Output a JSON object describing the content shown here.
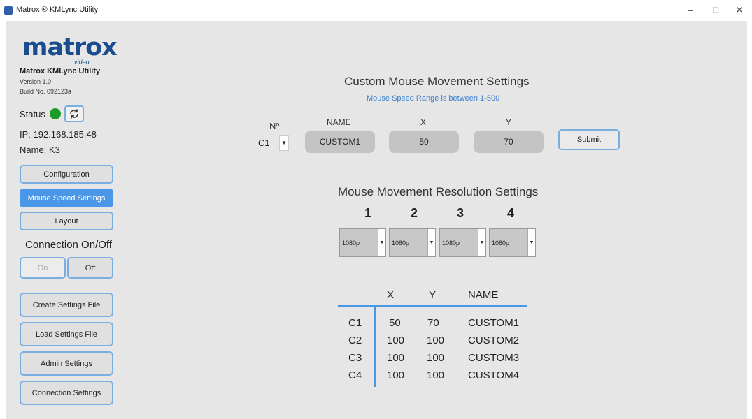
{
  "window": {
    "title": "Matrox ® KMLync Utility",
    "minimize": "–",
    "maximize": "☐",
    "close": "✕"
  },
  "sidebar": {
    "logo_text": "matrox",
    "logo_sub": "video",
    "app_name": "Matrox KMLync Utility",
    "version": "Version 1.0",
    "build": "Build No. 092123a",
    "status_label": "Status",
    "status_color": "#1e9a2a",
    "ip": "IP: 192.168.185.48",
    "name": "Name: K3",
    "nav": {
      "configuration": "Configuration",
      "mouse_speed": "Mouse Speed Settings",
      "layout": "Layout"
    },
    "connection_label": "Connection On/Off",
    "on": "On",
    "off": "Off",
    "create_settings": "Create Settings File",
    "load_settings": "Load Settings File",
    "admin_settings": "Admin Settings",
    "connection_settings": "Connection Settings"
  },
  "custom": {
    "title": "Custom Mouse Movement Settings",
    "range_note": "Mouse Speed Range is between 1-500",
    "col_no": "Nº",
    "col_name": "NAME",
    "col_x": "X",
    "col_y": "Y",
    "selected_no": "C1",
    "name_value": "CUSTOM1",
    "x_value": "50",
    "y_value": "70",
    "submit": "Submit"
  },
  "resolution": {
    "title": "Mouse Movement Resolution Settings",
    "columns": [
      {
        "num": "1",
        "value": "1080p"
      },
      {
        "num": "2",
        "value": "1080p"
      },
      {
        "num": "3",
        "value": "1080p"
      },
      {
        "num": "4",
        "value": "1080p"
      }
    ]
  },
  "table": {
    "headers": {
      "x": "X",
      "y": "Y",
      "name": "NAME"
    },
    "rows": [
      {
        "id": "C1",
        "x": "50",
        "y": "70",
        "name": "CUSTOM1"
      },
      {
        "id": "C2",
        "x": "100",
        "y": "100",
        "name": "CUSTOM2"
      },
      {
        "id": "C3",
        "x": "100",
        "y": "100",
        "name": "CUSTOM3"
      },
      {
        "id": "C4",
        "x": "100",
        "y": "100",
        "name": "CUSTOM4"
      }
    ]
  },
  "accent_color": "#4a97e8"
}
